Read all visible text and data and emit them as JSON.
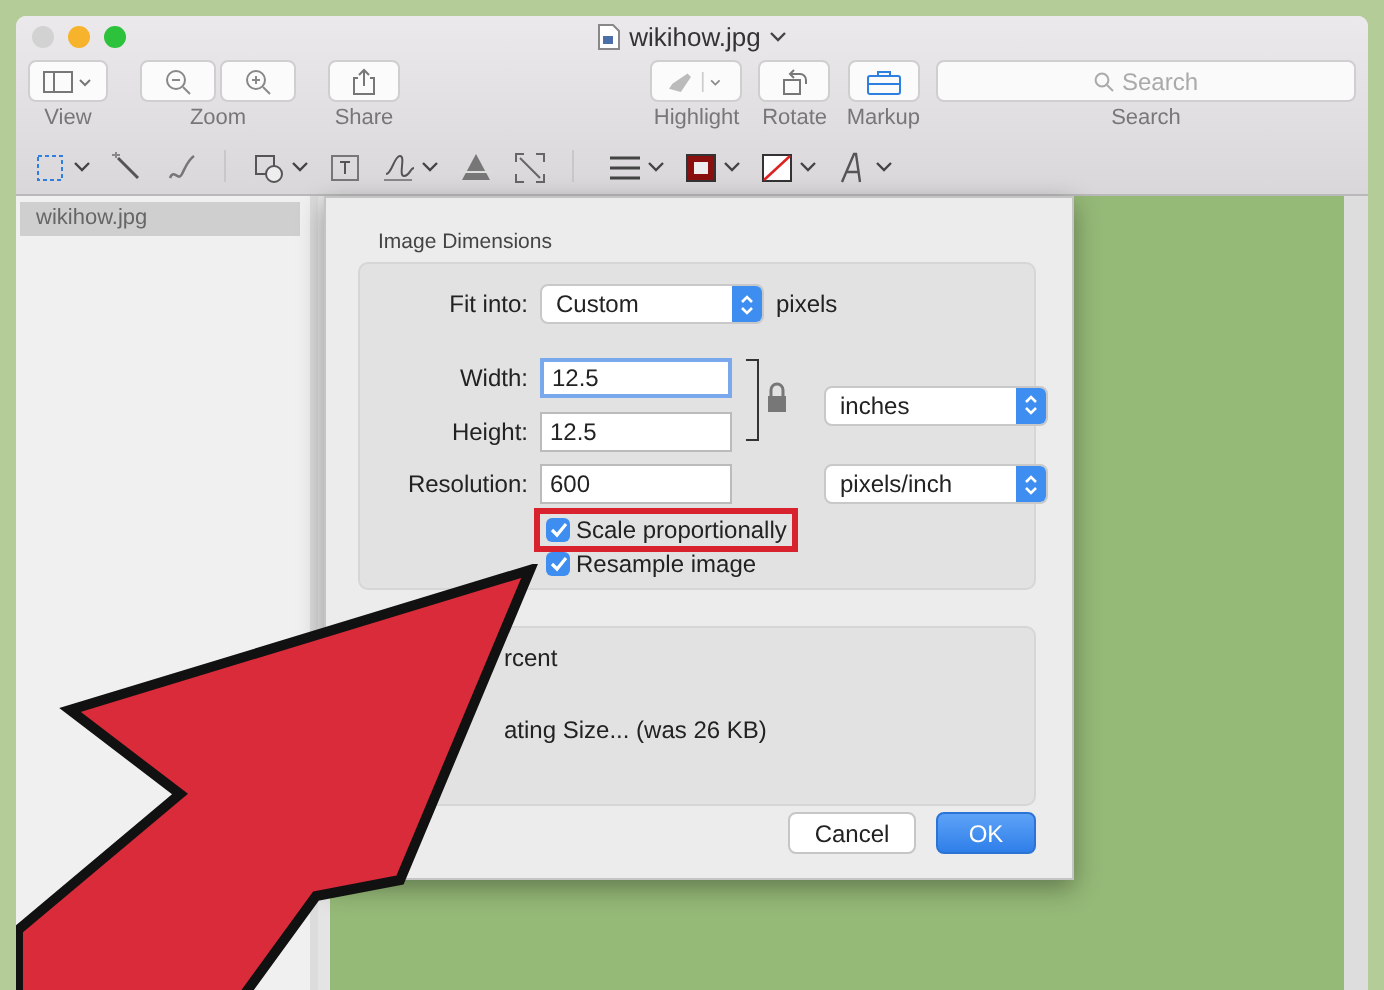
{
  "window": {
    "title": "wikihow.jpg"
  },
  "toolbar": {
    "buttons": [
      {
        "label": "View",
        "kind": "view"
      },
      {
        "label": "Zoom",
        "kind": "zoom"
      },
      {
        "label": "Share",
        "kind": "share"
      },
      {
        "label": "Highlight",
        "kind": "highlight"
      },
      {
        "label": "Rotate",
        "kind": "rotate"
      },
      {
        "label": "Markup",
        "kind": "markup"
      }
    ],
    "search": {
      "placeholder": "Search",
      "label": "Search"
    }
  },
  "sidebar": {
    "items": [
      {
        "label": "wikihow.jpg",
        "selected": true
      }
    ]
  },
  "dialog": {
    "section_title": "Image Dimensions",
    "fit_into": {
      "label": "Fit into:",
      "value": "Custom",
      "unit": "pixels"
    },
    "width": {
      "label": "Width:",
      "value": "12.5"
    },
    "height": {
      "label": "Height:",
      "value": "12.5"
    },
    "size_unit": "inches",
    "resolution": {
      "label": "Resolution:",
      "value": "600",
      "unit": "pixels/inch"
    },
    "checkboxes": [
      {
        "label": "Scale proportionally",
        "checked": true,
        "highlighted": true
      },
      {
        "label": "Resample image",
        "checked": true,
        "highlighted": false
      }
    ],
    "result_lines": [
      "rcent",
      "ating Size... (was 26 KB)"
    ],
    "buttons": [
      {
        "label": "Cancel",
        "kind": "secondary"
      },
      {
        "label": "OK",
        "kind": "primary"
      }
    ]
  }
}
